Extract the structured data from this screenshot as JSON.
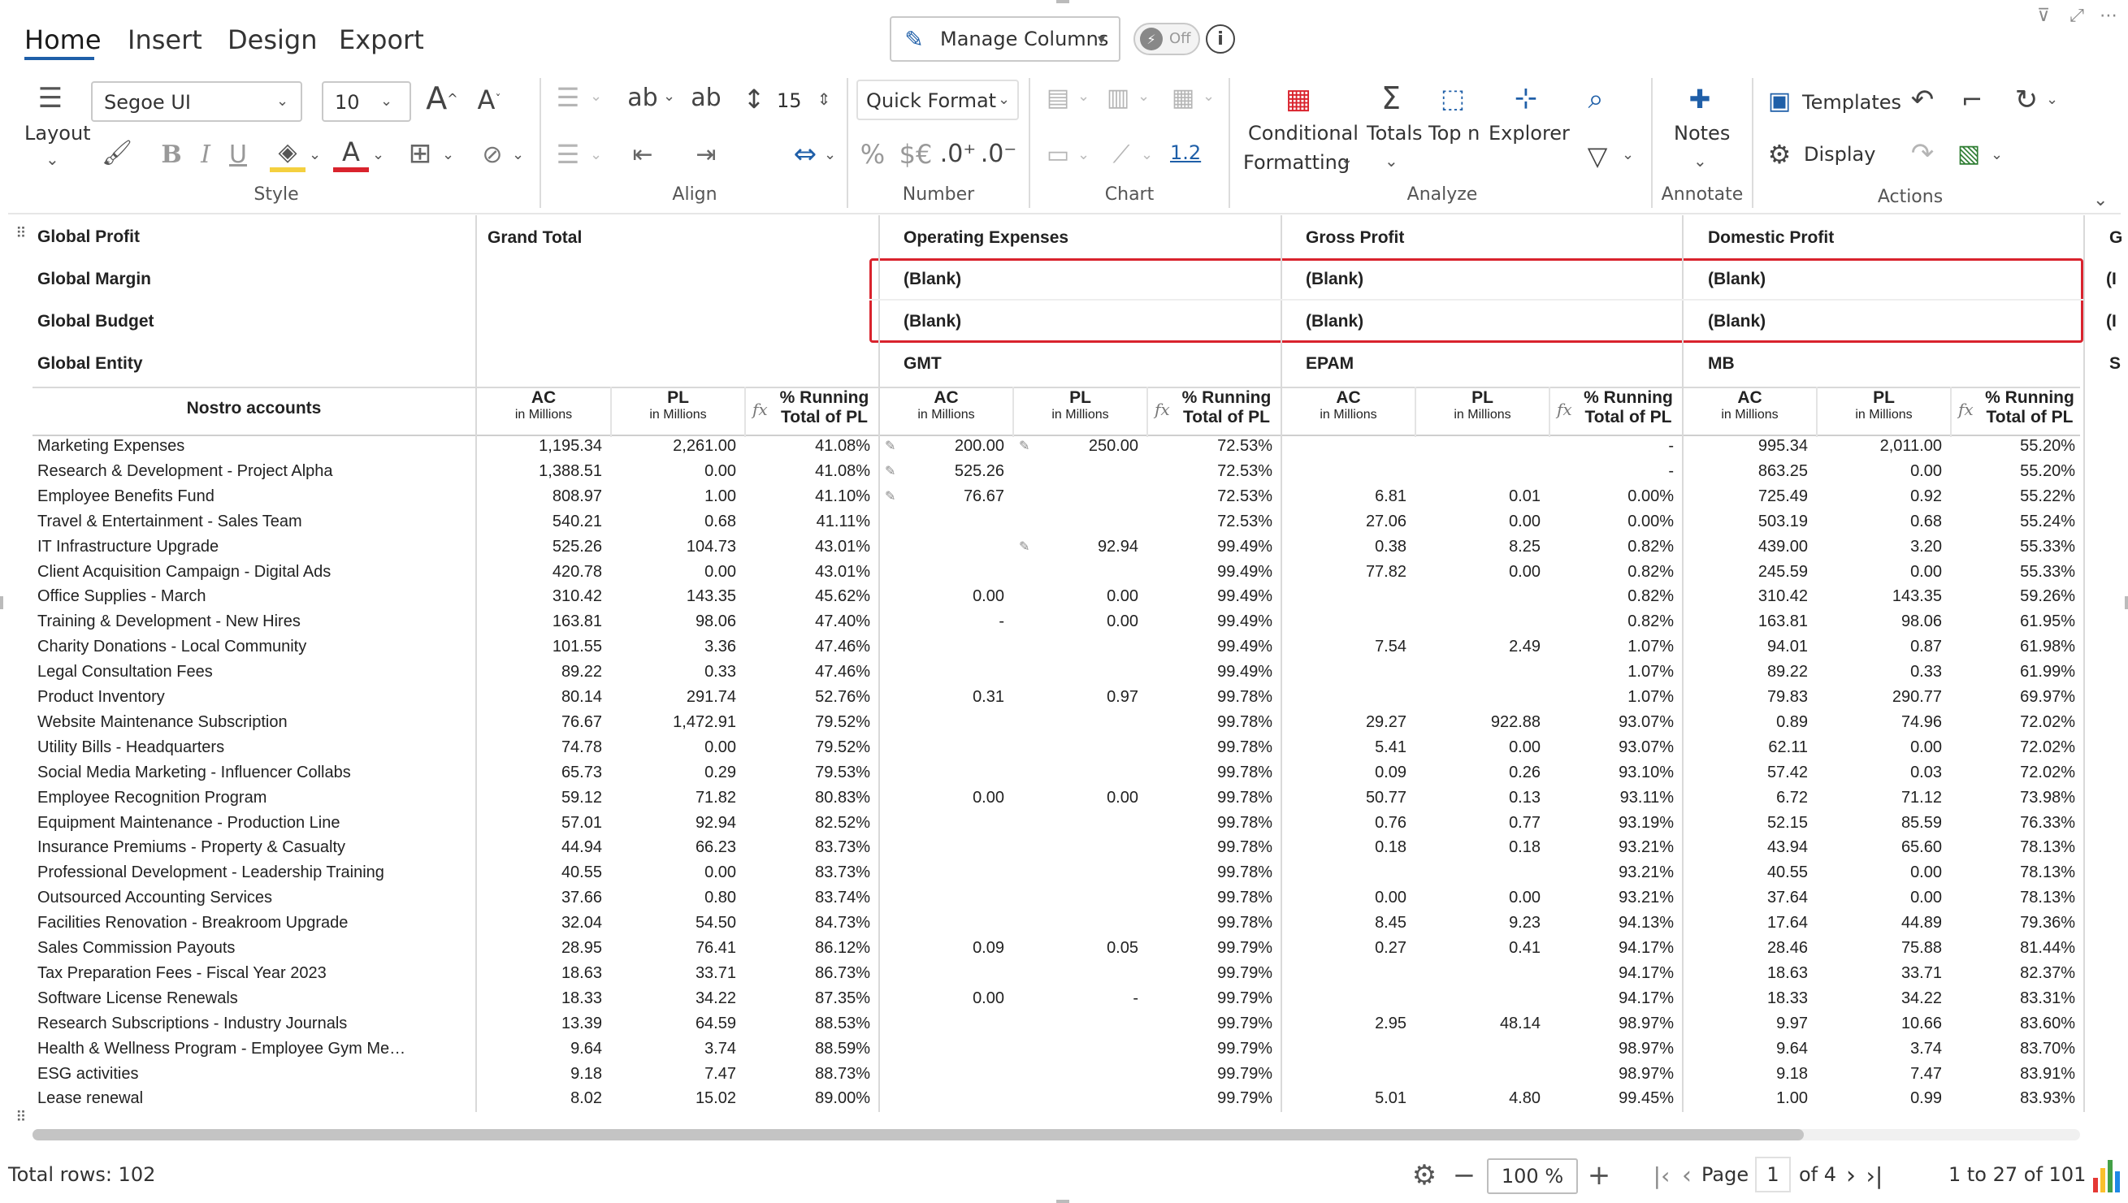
{
  "ribbon": {
    "tabs": [
      "Home",
      "Insert",
      "Design",
      "Export"
    ],
    "manage_columns": "Manage Columns",
    "toggle_label": "Off",
    "font_family": "Segoe UI",
    "font_size": "10",
    "line_height": "15",
    "quick_format": "Quick Format",
    "precision_label": "1.2",
    "labels": {
      "layout": "Layout",
      "conditional_formatting_1": "Conditional",
      "conditional_formatting_2": "Formatting",
      "totals": "Totals",
      "top_n": "Top n",
      "explorer": "Explorer",
      "notes": "Notes",
      "templates": "Templates",
      "display": "Display"
    },
    "groups": {
      "style": "Style",
      "align": "Align",
      "number": "Number",
      "chart": "Chart",
      "analyze": "Analyze",
      "annotate": "Annotate",
      "actions": "Actions"
    },
    "accent_color": "#1f5fa8"
  },
  "grid": {
    "row_headers": {
      "global_profit": "Global Profit",
      "global_margin": "Global Margin",
      "global_budget": "Global Budget",
      "global_entity": "Global Entity"
    },
    "groups": {
      "grand_total": "Grand Total",
      "operating_expenses": "Operating Expenses",
      "gross_profit": "Gross Profit",
      "domestic_profit": "Domestic Profit",
      "clipped": "G"
    },
    "blank": "(Blank)",
    "blank_clipped": "(I",
    "entities": [
      "GMT",
      "EPAM",
      "MB",
      "S"
    ],
    "row_dim_header": "Nostro accounts",
    "col_headers": {
      "ac": "AC",
      "pl": "PL",
      "sub": "in Millions",
      "running_1": "% Running",
      "running_2": "Total of PL",
      "fx": "fx"
    },
    "highlight_color": "#d9232d",
    "rows": [
      {
        "name": "Marketing Expenses",
        "v": [
          "1,195.34",
          "2,261.00",
          "41.08%",
          "200.00",
          "250.00",
          "72.53%",
          "",
          "",
          "-",
          "995.34",
          "2,011.00",
          "55.20%"
        ],
        "e": [
          1,
          1,
          0
        ]
      },
      {
        "name": "Research & Development - Project Alpha",
        "v": [
          "1,388.51",
          "0.00",
          "41.08%",
          "525.26",
          "",
          "72.53%",
          "",
          "",
          "-",
          "863.25",
          "0.00",
          "55.20%"
        ],
        "e": [
          1,
          0,
          0
        ]
      },
      {
        "name": "Employee Benefits Fund",
        "v": [
          "808.97",
          "1.00",
          "41.10%",
          "76.67",
          "",
          "72.53%",
          "6.81",
          "0.01",
          "0.00%",
          "725.49",
          "0.92",
          "55.22%"
        ],
        "e": [
          1,
          0,
          0
        ]
      },
      {
        "name": "Travel & Entertainment - Sales Team",
        "v": [
          "540.21",
          "0.68",
          "41.11%",
          "",
          "",
          "72.53%",
          "27.06",
          "0.00",
          "0.00%",
          "503.19",
          "0.68",
          "55.24%"
        ],
        "e": [
          0,
          0,
          0
        ]
      },
      {
        "name": "IT Infrastructure Upgrade",
        "v": [
          "525.26",
          "104.73",
          "43.01%",
          "",
          "92.94",
          "99.49%",
          "0.38",
          "8.25",
          "0.82%",
          "439.00",
          "3.20",
          "55.33%"
        ],
        "e": [
          0,
          1,
          0
        ]
      },
      {
        "name": "Client Acquisition Campaign - Digital Ads",
        "v": [
          "420.78",
          "0.00",
          "43.01%",
          "",
          "",
          "99.49%",
          "77.82",
          "0.00",
          "0.82%",
          "245.59",
          "0.00",
          "55.33%"
        ],
        "e": [
          0,
          0,
          0
        ]
      },
      {
        "name": "Office Supplies - March",
        "v": [
          "310.42",
          "143.35",
          "45.62%",
          "0.00",
          "0.00",
          "99.49%",
          "",
          "",
          "0.82%",
          "310.42",
          "143.35",
          "59.26%"
        ],
        "e": [
          0,
          0,
          0
        ]
      },
      {
        "name": "Training & Development - New Hires",
        "v": [
          "163.81",
          "98.06",
          "47.40%",
          "-",
          "0.00",
          "99.49%",
          "",
          "",
          "0.82%",
          "163.81",
          "98.06",
          "61.95%"
        ],
        "e": [
          0,
          0,
          0
        ]
      },
      {
        "name": "Charity Donations - Local Community",
        "v": [
          "101.55",
          "3.36",
          "47.46%",
          "",
          "",
          "99.49%",
          "7.54",
          "2.49",
          "1.07%",
          "94.01",
          "0.87",
          "61.98%"
        ],
        "e": [
          0,
          0,
          0
        ]
      },
      {
        "name": "Legal Consultation Fees",
        "v": [
          "89.22",
          "0.33",
          "47.46%",
          "",
          "",
          "99.49%",
          "",
          "",
          "1.07%",
          "89.22",
          "0.33",
          "61.99%"
        ],
        "e": [
          0,
          0,
          0
        ]
      },
      {
        "name": "Product Inventory",
        "v": [
          "80.14",
          "291.74",
          "52.76%",
          "0.31",
          "0.97",
          "99.78%",
          "",
          "",
          "1.07%",
          "79.83",
          "290.77",
          "69.97%"
        ],
        "e": [
          0,
          0,
          0
        ]
      },
      {
        "name": "Website Maintenance Subscription",
        "v": [
          "76.67",
          "1,472.91",
          "79.52%",
          "",
          "",
          "99.78%",
          "29.27",
          "922.88",
          "93.07%",
          "0.89",
          "74.96",
          "72.02%"
        ],
        "e": [
          0,
          0,
          0
        ]
      },
      {
        "name": "Utility Bills - Headquarters",
        "v": [
          "74.78",
          "0.00",
          "79.52%",
          "",
          "",
          "99.78%",
          "5.41",
          "0.00",
          "93.07%",
          "62.11",
          "0.00",
          "72.02%"
        ],
        "e": [
          0,
          0,
          0
        ]
      },
      {
        "name": "Social Media Marketing - Influencer Collabs",
        "v": [
          "65.73",
          "0.29",
          "79.53%",
          "",
          "",
          "99.78%",
          "0.09",
          "0.26",
          "93.10%",
          "57.42",
          "0.03",
          "72.02%"
        ],
        "e": [
          0,
          0,
          0
        ]
      },
      {
        "name": "Employee Recognition Program",
        "v": [
          "59.12",
          "71.82",
          "80.83%",
          "0.00",
          "0.00",
          "99.78%",
          "50.77",
          "0.13",
          "93.11%",
          "6.72",
          "71.12",
          "73.98%"
        ],
        "e": [
          0,
          0,
          0
        ]
      },
      {
        "name": "Equipment Maintenance - Production Line",
        "v": [
          "57.01",
          "92.94",
          "82.52%",
          "",
          "",
          "99.78%",
          "0.76",
          "0.77",
          "93.19%",
          "52.15",
          "85.59",
          "76.33%"
        ],
        "e": [
          0,
          0,
          0
        ]
      },
      {
        "name": "Insurance Premiums - Property & Casualty",
        "v": [
          "44.94",
          "66.23",
          "83.73%",
          "",
          "",
          "99.78%",
          "0.18",
          "0.18",
          "93.21%",
          "43.94",
          "65.60",
          "78.13%"
        ],
        "e": [
          0,
          0,
          0
        ]
      },
      {
        "name": "Professional Development - Leadership Training",
        "v": [
          "40.55",
          "0.00",
          "83.73%",
          "",
          "",
          "99.78%",
          "",
          "",
          "93.21%",
          "40.55",
          "0.00",
          "78.13%"
        ],
        "e": [
          0,
          0,
          0
        ]
      },
      {
        "name": "Outsourced Accounting Services",
        "v": [
          "37.66",
          "0.80",
          "83.74%",
          "",
          "",
          "99.78%",
          "0.00",
          "0.00",
          "93.21%",
          "37.64",
          "0.00",
          "78.13%"
        ],
        "e": [
          0,
          0,
          0
        ]
      },
      {
        "name": "Facilities Renovation - Breakroom Upgrade",
        "v": [
          "32.04",
          "54.50",
          "84.73%",
          "",
          "",
          "99.78%",
          "8.45",
          "9.23",
          "94.13%",
          "17.64",
          "44.89",
          "79.36%"
        ],
        "e": [
          0,
          0,
          0
        ]
      },
      {
        "name": "Sales Commission Payouts",
        "v": [
          "28.95",
          "76.41",
          "86.12%",
          "0.09",
          "0.05",
          "99.79%",
          "0.27",
          "0.41",
          "94.17%",
          "28.46",
          "75.88",
          "81.44%"
        ],
        "e": [
          0,
          0,
          0
        ]
      },
      {
        "name": "Tax Preparation Fees - Fiscal Year 2023",
        "v": [
          "18.63",
          "33.71",
          "86.73%",
          "",
          "",
          "99.79%",
          "",
          "",
          "94.17%",
          "18.63",
          "33.71",
          "82.37%"
        ],
        "e": [
          0,
          0,
          0
        ]
      },
      {
        "name": "Software License Renewals",
        "v": [
          "18.33",
          "34.22",
          "87.35%",
          "0.00",
          "-",
          "99.79%",
          "",
          "",
          "94.17%",
          "18.33",
          "34.22",
          "83.31%"
        ],
        "e": [
          0,
          0,
          0
        ]
      },
      {
        "name": "Research Subscriptions - Industry Journals",
        "v": [
          "13.39",
          "64.59",
          "88.53%",
          "",
          "",
          "99.79%",
          "2.95",
          "48.14",
          "98.97%",
          "9.97",
          "10.66",
          "83.60%"
        ],
        "e": [
          0,
          0,
          0
        ]
      },
      {
        "name": "Health & Wellness Program - Employee Gym Me…",
        "v": [
          "9.64",
          "3.74",
          "88.59%",
          "",
          "",
          "99.79%",
          "",
          "",
          "98.97%",
          "9.64",
          "3.74",
          "83.70%"
        ],
        "e": [
          0,
          0,
          0
        ]
      },
      {
        "name": "ESG activities",
        "v": [
          "9.18",
          "7.47",
          "88.73%",
          "",
          "",
          "99.79%",
          "",
          "",
          "98.97%",
          "9.18",
          "7.47",
          "83.91%"
        ],
        "e": [
          0,
          0,
          0
        ]
      },
      {
        "name": "Lease renewal",
        "v": [
          "8.02",
          "15.02",
          "89.00%",
          "",
          "",
          "99.79%",
          "5.01",
          "4.80",
          "99.45%",
          "1.00",
          "0.99",
          "83.93%"
        ],
        "e": [
          0,
          0,
          0
        ]
      }
    ]
  },
  "footer": {
    "total_rows": "Total rows: 102",
    "zoom": "100 %",
    "page_label": "Page",
    "page_value": "1",
    "of_pages": "of 4",
    "range": "1 to 27 of 101"
  }
}
